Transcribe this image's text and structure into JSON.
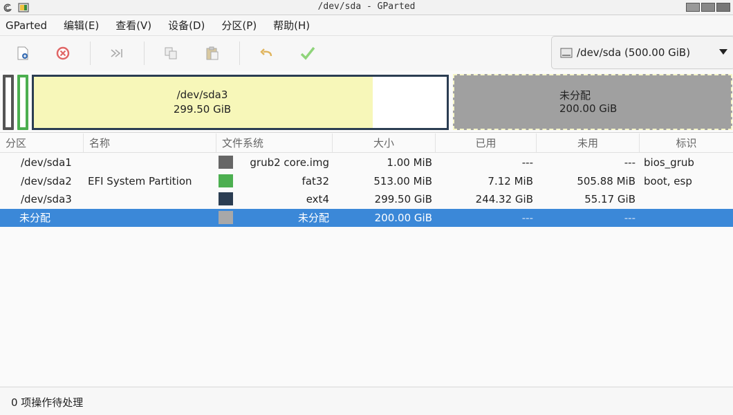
{
  "window": {
    "title": "/dev/sda - GParted"
  },
  "menubar": [
    "GParted",
    "编辑(E)",
    "查看(V)",
    "设备(D)",
    "分区(P)",
    "帮助(H)"
  ],
  "toolbar": {
    "buttons": [
      "new-partition",
      "delete-partition",
      "resize-move",
      "copy",
      "paste",
      "undo",
      "apply"
    ],
    "device_selector": "/dev/sda (500.00 GiB)"
  },
  "diskmap": {
    "sda3": {
      "name": "/dev/sda3",
      "size": "299.50 GiB",
      "used_fraction": 0.82
    },
    "unallocated": {
      "name": "未分配",
      "size": "200.00 GiB"
    }
  },
  "table": {
    "columns": [
      "分区",
      "名称",
      "文件系统",
      "大小",
      "已用",
      "未用",
      "标识"
    ],
    "rows": [
      {
        "partition": "/dev/sda1",
        "name": "",
        "fs_color": "#666666",
        "filesystem": "grub2 core.img",
        "size": "1.00 MiB",
        "used": "---",
        "unused": "---",
        "flags": "bios_grub",
        "selected": false
      },
      {
        "partition": "/dev/sda2",
        "name": "EFI System Partition",
        "fs_color": "#4caf50",
        "filesystem": "fat32",
        "size": "513.00 MiB",
        "used": "7.12 MiB",
        "unused": "505.88 MiB",
        "flags": "boot, esp",
        "selected": false
      },
      {
        "partition": "/dev/sda3",
        "name": "",
        "fs_color": "#2b3d52",
        "filesystem": "ext4",
        "size": "299.50 GiB",
        "used": "244.32 GiB",
        "unused": "55.17 GiB",
        "flags": "",
        "selected": false
      },
      {
        "partition": "未分配",
        "name": "",
        "fs_color": "#a8a8a8",
        "filesystem": "未分配",
        "size": "200.00 GiB",
        "used": "---",
        "unused": "---",
        "flags": "",
        "selected": true
      }
    ]
  },
  "statusbar": {
    "text": "0 项操作待处理"
  },
  "colors": {
    "selection": "#3b88d8",
    "ext4": "#2b3d52",
    "fat32": "#4caf50",
    "unallocated": "#a0a0a0",
    "used_space": "#f7f7b9"
  }
}
